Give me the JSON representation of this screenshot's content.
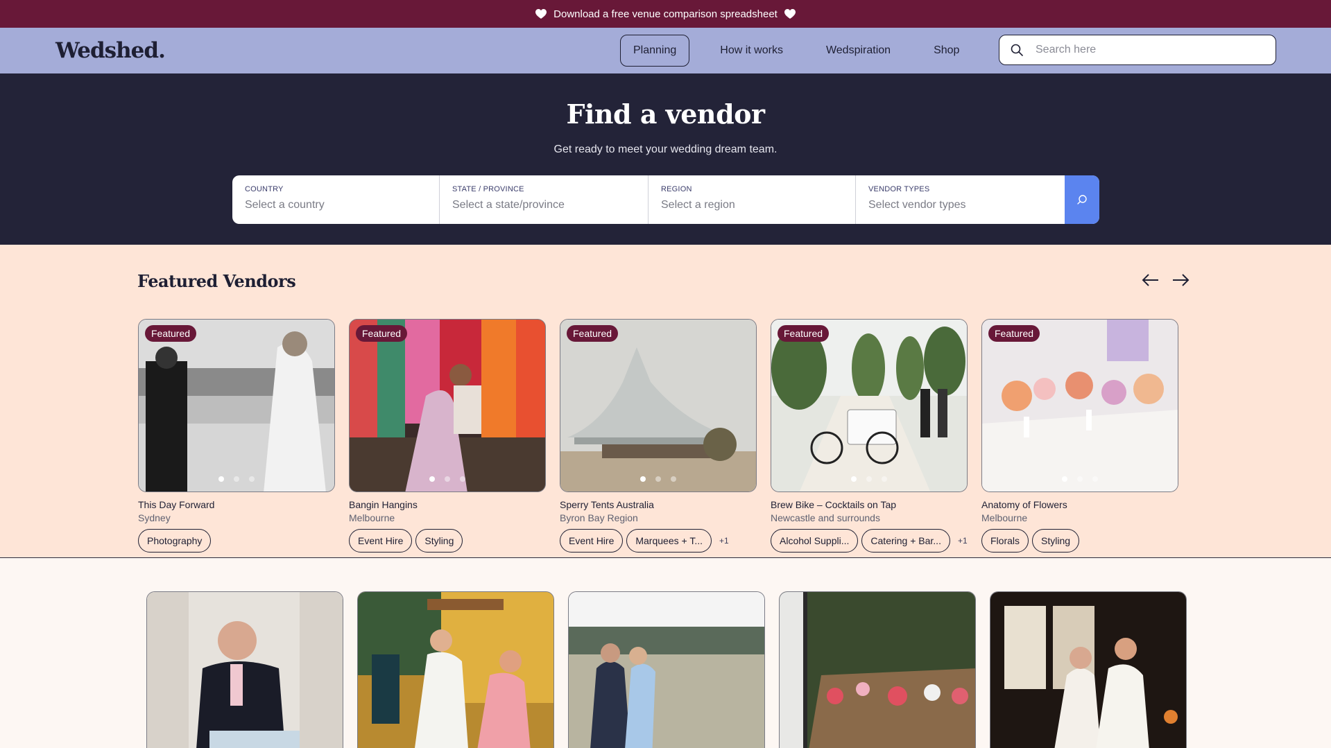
{
  "promo": {
    "text": "Download a free venue comparison spreadsheet"
  },
  "nav": {
    "logo": "Wedshed.",
    "links": [
      "Planning",
      "How it works",
      "Wedspiration",
      "Shop"
    ],
    "search_placeholder": "Search here"
  },
  "hero": {
    "title": "Find a vendor",
    "subtitle": "Get ready to meet your wedding dream team.",
    "filters": [
      {
        "label": "Country",
        "value": "Select a country"
      },
      {
        "label": "State / Province",
        "value": "Select a state/province"
      },
      {
        "label": "Region",
        "value": "Select a region"
      },
      {
        "label": "Vendor types",
        "value": "Select vendor types"
      }
    ]
  },
  "featured": {
    "heading": "Featured Vendors",
    "badge": "Featured",
    "cards": [
      {
        "name": "This Day Forward",
        "location": "Sydney",
        "tags": [
          "Photography"
        ],
        "more": ""
      },
      {
        "name": "Bangin Hangins",
        "location": "Melbourne",
        "tags": [
          "Event Hire",
          "Styling"
        ],
        "more": ""
      },
      {
        "name": "Sperry Tents Australia",
        "location": "Byron Bay Region",
        "tags": [
          "Event Hire",
          "Marquees + T..."
        ],
        "more": "+1"
      },
      {
        "name": "Brew Bike – Cocktails on Tap",
        "location": "Newcastle and surrounds",
        "tags": [
          "Alcohol Suppli...",
          "Catering + Bar..."
        ],
        "more": "+1"
      },
      {
        "name": "Anatomy of Flowers",
        "location": "Melbourne",
        "tags": [
          "Florals",
          "Styling"
        ],
        "more": ""
      }
    ]
  },
  "colors": {
    "promo_bg": "#681838",
    "nav_bg": "#a4acd8",
    "hero_bg": "#232338",
    "featured_bg": "#fee5d7",
    "accent_blue": "#5b84ef",
    "badge": "#681838"
  },
  "icons": {
    "promo": "heart-icon",
    "search": "search-icon",
    "filter_search": "search-icon",
    "prev": "arrow-left-icon",
    "next": "arrow-right-icon"
  }
}
